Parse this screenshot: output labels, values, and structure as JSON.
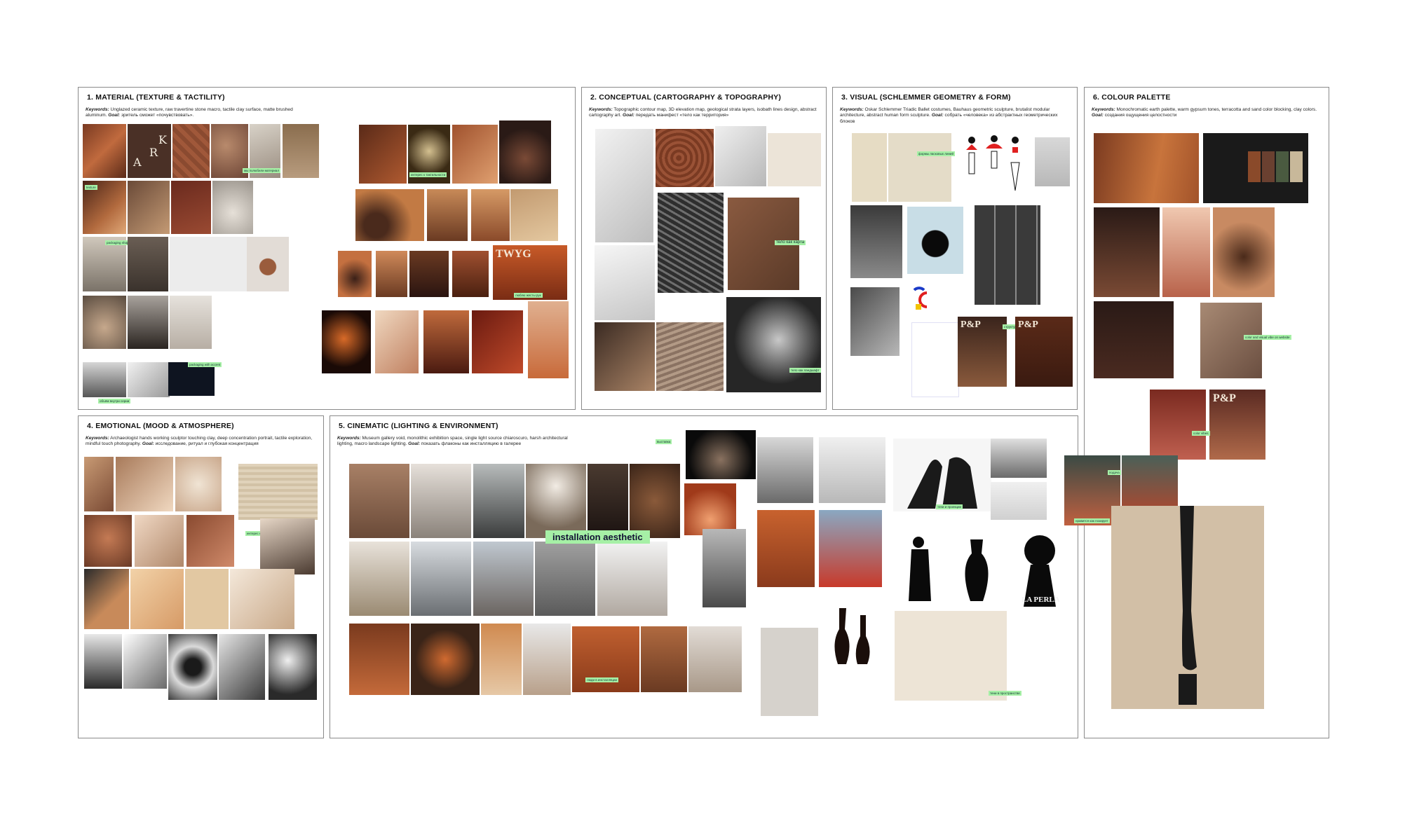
{
  "panels": [
    {
      "title": "1. MATERIAL (TEXTURE & TACTILITY)",
      "kw_label": "Keywords:",
      "kw_text": " Unglazed ceramic texture, raw travertine stone macro, tactile clay surface, matte brushed aluminum. ",
      "goal_label": "Goal:",
      "goal_text": " зритель сможет «почувствовать»."
    },
    {
      "title": "2. CONCEPTUAL (CARTOGRAPHY & TOPOGRAPHY)",
      "kw_label": "Keywords:",
      "kw_text": " Topographic contour map, 3D elevation map, geological strata layers, isobath lines design, abstract cartography art. ",
      "goal_label": "Goal:",
      "goal_text": " передать манифест «тело как территория»"
    },
    {
      "title": "3. VISUAL (SCHLEMMER GEOMETRY & FORM)",
      "kw_label": "Keywords:",
      "kw_text": " Oskar Schlemmer Triadic Ballet costumes, Bauhaus geometric sculpture, brutalist modular architecture, abstract human form sculpture. ",
      "goal_label": "Goal:",
      "goal_text": " собрать «человека» из абстрактных геометрических блоков"
    },
    {
      "title": "6. COLOUR PALETTE",
      "kw_label": "Keywords:",
      "kw_text": " Monochromatic earth palette, warm gypsum tones, terracotta and sand color blocking, clay colors. ",
      "goal_label": "Goal:",
      "goal_text": " создания ощущения целостности"
    },
    {
      "title": "4. EMOTIONAL (MOOD & ATMOSPHERE)",
      "kw_label": "Keywords:",
      "kw_text": " Archaeologist hands working sculptor touching clay, deep concentration portrait, tactile exploration, mindful touch photography. ",
      "goal_label": "Goal:",
      "goal_text": " исследование, ритуал и глубокая концентрация"
    },
    {
      "title": "5. CINEMATIC (LIGHTING & ENVIRONMENT)",
      "kw_label": "Keywords:",
      "kw_text": " Museum gallery void, monolithic exhibition space, single light source chiaroscuro, harsh architectural lighting, macro landscape lighting. ",
      "goal_label": "Goal:",
      "goal_text": " показать флаконы как инсталляцию в галерее"
    }
  ],
  "stickies": {
    "s1": "texture",
    "s2": "мы полюбили материал",
    "s3": "packaging shape and material",
    "s4": "packaging with accent",
    "s5": "объём внутри серии",
    "s6": "тело как карта",
    "s7": "тело как ландшафт",
    "s8": "формы ласковых линий",
    "s9": "структурная фигура",
    "s10": "color and visual vibe on website",
    "s11": "color vibes",
    "s12": "нравится как позирует",
    "s13": "подача",
    "s14": "интерес к тактильности",
    "s15": "люблю жесты рук",
    "s16": "installation aesthetic",
    "s17": "выставка",
    "s18": "тени и проекции",
    "s19": "люди в инсталляции",
    "s20": "тени в пространстве"
  },
  "brands": {
    "twyg": "TWYG",
    "laperla": "LA PERLA",
    "pop": "P&P",
    "ark": [
      "A",
      "R",
      "K"
    ]
  }
}
